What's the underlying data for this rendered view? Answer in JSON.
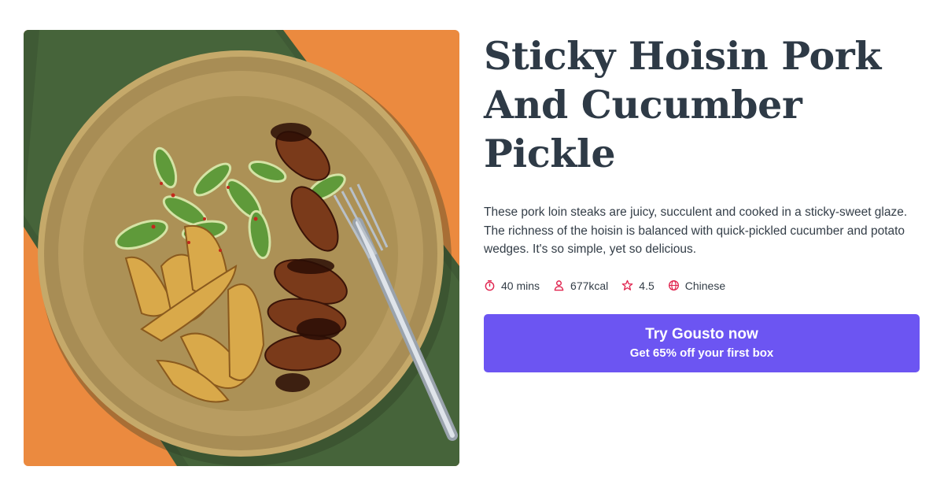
{
  "recipe": {
    "title": "Sticky Hoisin Pork And Cucumber Pickle",
    "description": "These pork loin steaks are juicy, succulent and cooked in a sticky-sweet glaze. The richness of the hoisin is balanced with quick-pickled cucumber and potato wedges. It's so simple, yet so delicious.",
    "image_alt": "Plate of sticky hoisin pork with cucumber pickle and potato wedges",
    "meta": {
      "time": {
        "label": "40 mins",
        "icon": "timer-icon"
      },
      "calories": {
        "label": "677kcal",
        "icon": "person-icon"
      },
      "rating": {
        "label": "4.5",
        "icon": "star-icon"
      },
      "cuisine": {
        "label": "Chinese",
        "icon": "globe-icon"
      }
    }
  },
  "cta": {
    "title": "Try Gousto now",
    "subtitle": "Get 65% off your first box"
  },
  "colors": {
    "accent": "#6c55f2",
    "icon": "#e0234e",
    "title": "#2e3a46",
    "text": "#333d47"
  }
}
